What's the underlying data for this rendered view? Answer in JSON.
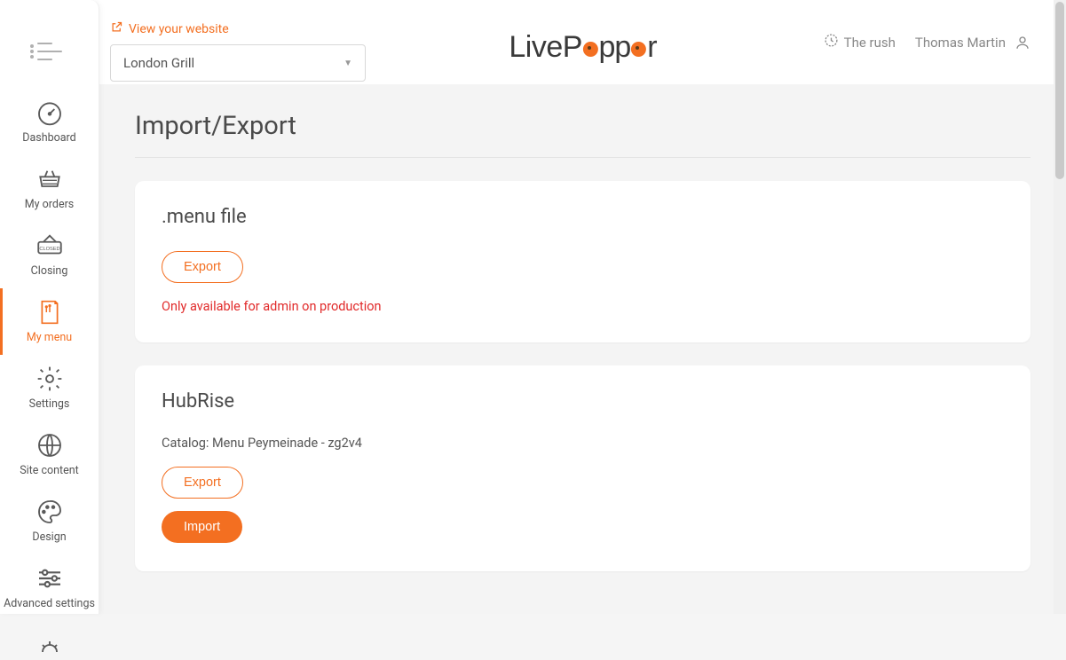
{
  "header": {
    "view_website_label": "View your website",
    "location_selected": "London Grill",
    "rush_label": "The rush",
    "user_name": "Thomas Martin",
    "logo_parts": {
      "first": "Live",
      "second": "Pepper"
    }
  },
  "sidebar": {
    "items": [
      {
        "label": "Dashboard",
        "icon": "gauge-icon",
        "active": false
      },
      {
        "label": "My orders",
        "icon": "basket-icon",
        "active": false
      },
      {
        "label": "Closing",
        "icon": "closed-sign-icon",
        "active": false
      },
      {
        "label": "My menu",
        "icon": "menu-book-icon",
        "active": true
      },
      {
        "label": "Settings",
        "icon": "gear-icon",
        "active": false
      },
      {
        "label": "Site content",
        "icon": "globe-icon",
        "active": false
      },
      {
        "label": "Design",
        "icon": "palette-icon",
        "active": false
      },
      {
        "label": "Advanced settings",
        "icon": "sliders-icon",
        "active": false
      }
    ]
  },
  "page": {
    "title": "Import/Export",
    "cards": [
      {
        "title": ".menu file",
        "export_label": "Export",
        "warn_text": "Only available for admin on production"
      },
      {
        "title": "HubRise",
        "catalog_line": "Catalog: Menu Peymeinade - zg2v4",
        "export_label": "Export",
        "import_label": "Import"
      }
    ]
  },
  "colors": {
    "accent": "#f36f21",
    "danger": "#e12b2b"
  }
}
